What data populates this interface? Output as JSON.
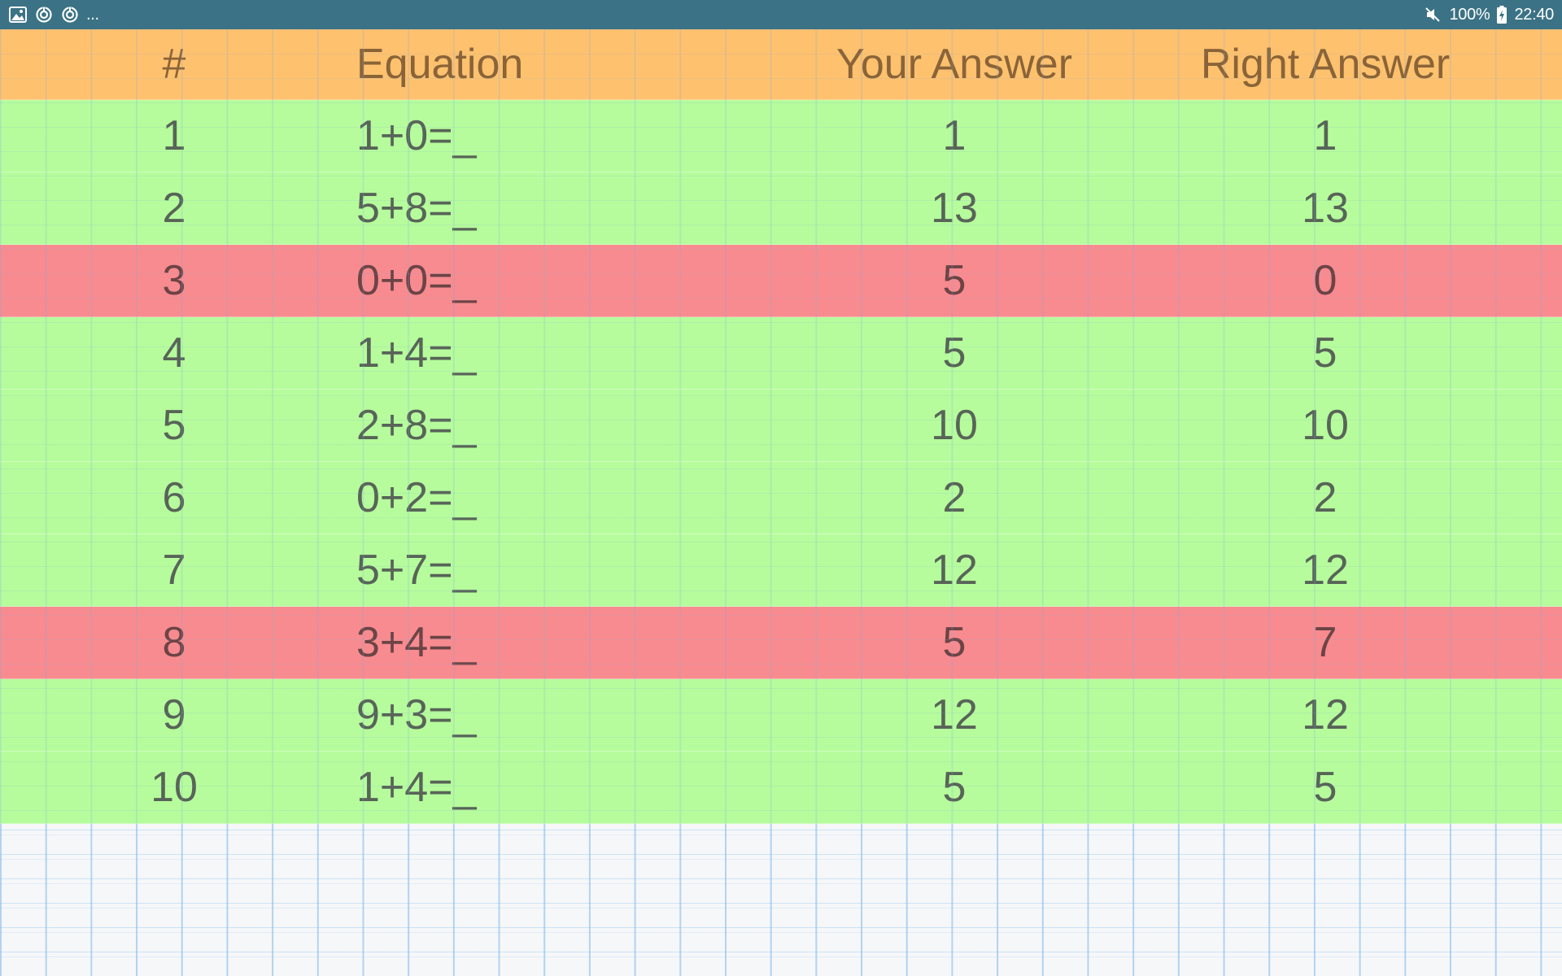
{
  "status_bar": {
    "left_icons": [
      "image-icon",
      "sync-icon",
      "sync-icon"
    ],
    "more": "...",
    "battery": "100%",
    "time": "22:40",
    "icons_right": [
      "mute-icon",
      "battery-charging-icon"
    ]
  },
  "table": {
    "headers": {
      "num": "#",
      "equation": "Equation",
      "your_answer": "Your Answer",
      "right_answer": "Right Answer"
    },
    "rows": [
      {
        "num": "1",
        "equation": "1+0=_",
        "your": "1",
        "right": "1",
        "correct": true
      },
      {
        "num": "2",
        "equation": "5+8=_",
        "your": "13",
        "right": "13",
        "correct": true
      },
      {
        "num": "3",
        "equation": "0+0=_",
        "your": "5",
        "right": "0",
        "correct": false
      },
      {
        "num": "4",
        "equation": "1+4=_",
        "your": "5",
        "right": "5",
        "correct": true
      },
      {
        "num": "5",
        "equation": "2+8=_",
        "your": "10",
        "right": "10",
        "correct": true
      },
      {
        "num": "6",
        "equation": "0+2=_",
        "your": "2",
        "right": "2",
        "correct": true
      },
      {
        "num": "7",
        "equation": "5+7=_",
        "your": "12",
        "right": "12",
        "correct": true
      },
      {
        "num": "8",
        "equation": "3+4=_",
        "your": "5",
        "right": "7",
        "correct": false
      },
      {
        "num": "9",
        "equation": "9+3=_",
        "your": "12",
        "right": "12",
        "correct": true
      },
      {
        "num": "10",
        "equation": "1+4=_",
        "your": "5",
        "right": "5",
        "correct": true
      }
    ]
  },
  "colors": {
    "status_bar": "#3b7285",
    "header": "#fec16e",
    "correct_row": "#b6fc9c",
    "wrong_row": "#f88b8f",
    "paper": "#f6f7f9"
  }
}
